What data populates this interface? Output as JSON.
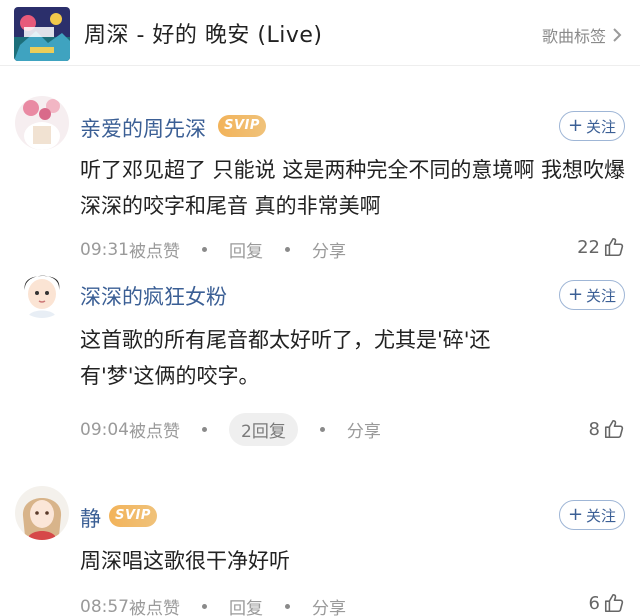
{
  "header": {
    "song_title": "周深 - 好的 晚安 (Live)",
    "tag_link": "歌曲标签"
  },
  "comments": [
    {
      "username": "亲爱的周先深",
      "badge": "SVIP",
      "follow_label": "关注",
      "text": "听了邓见超了 只能说 这是两种完全不同的意境啊 我想吹爆深深的咬字和尾音 真的非常美啊",
      "time": "09:31",
      "liked_label": "被点赞",
      "reply_label": "回复",
      "share_label": "分享",
      "likes": "22"
    },
    {
      "username": "深深的疯狂女粉",
      "badge": "",
      "follow_label": "关注",
      "text": "这首歌的所有尾音都太好听了，尤其是'碎'还有'梦'这俩的咬字。",
      "time": "09:04",
      "liked_label": "被点赞",
      "reply_label": "2回复",
      "share_label": "分享",
      "likes": "8"
    },
    {
      "username": "静",
      "badge": "SVIP",
      "follow_label": "关注",
      "text": "周深唱这歌很干净好听",
      "time": "08:57",
      "liked_label": "被点赞",
      "reply_label": "回复",
      "share_label": "分享",
      "likes": "6"
    }
  ],
  "colors": {
    "username": "#3b5f95",
    "svip": "#f2b35a",
    "meta": "#9a9a9a"
  }
}
